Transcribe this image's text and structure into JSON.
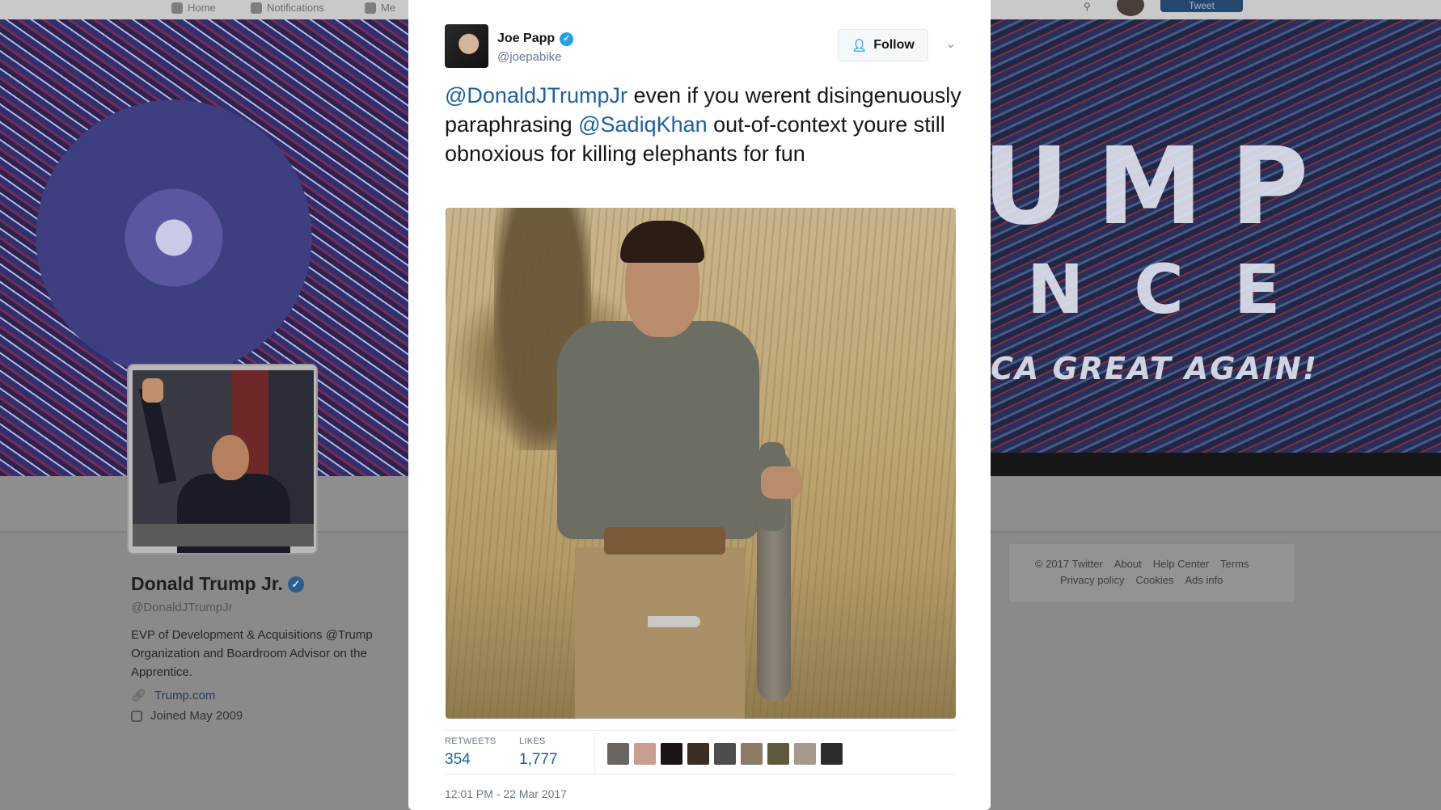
{
  "topnav": {
    "items": [
      "Home",
      "Notifications",
      "Me"
    ],
    "tweet_button": "Tweet"
  },
  "banner": {
    "line1": "UMP",
    "line2": "NCE",
    "line3": "CA GREAT AGAIN!"
  },
  "profile": {
    "name": "Donald Trump Jr.",
    "verified_mark": "✓",
    "handle": "@DonaldJTrumpJr",
    "bio": "EVP of Development & Acquisitions @Trump Organization and Boardroom Advisor on the Apprentice.",
    "link": "Trump.com",
    "joined": "Joined May 2009"
  },
  "footer": {
    "row1": [
      "© 2017 Twitter",
      "About",
      "Help Center",
      "Terms"
    ],
    "row2": [
      "Privacy policy",
      "Cookies",
      "Ads info"
    ]
  },
  "tweet": {
    "author_name": "Joe Papp",
    "verified_mark": "✓",
    "author_handle": "@joepabike",
    "follow_label": "Follow",
    "follow_icon": "person-plus-icon",
    "caret": "⌄",
    "mention1": "@DonaldJTrumpJr",
    "text1": " even if you werent disingenuously paraphrasing ",
    "mention2": "@SadiqKhan",
    "text2": " out-of-context youre still obnoxious for killing elephants for fun",
    "retweets_label": "RETWEETS",
    "retweets": "354",
    "likes_label": "LIKES",
    "likes": "1,777",
    "timestamp": "12:01 PM - 22 Mar 2017"
  },
  "colors": {
    "link_blue": "#1b5fa8",
    "verified_blue": "#1da1f2",
    "muted": "#657786"
  }
}
